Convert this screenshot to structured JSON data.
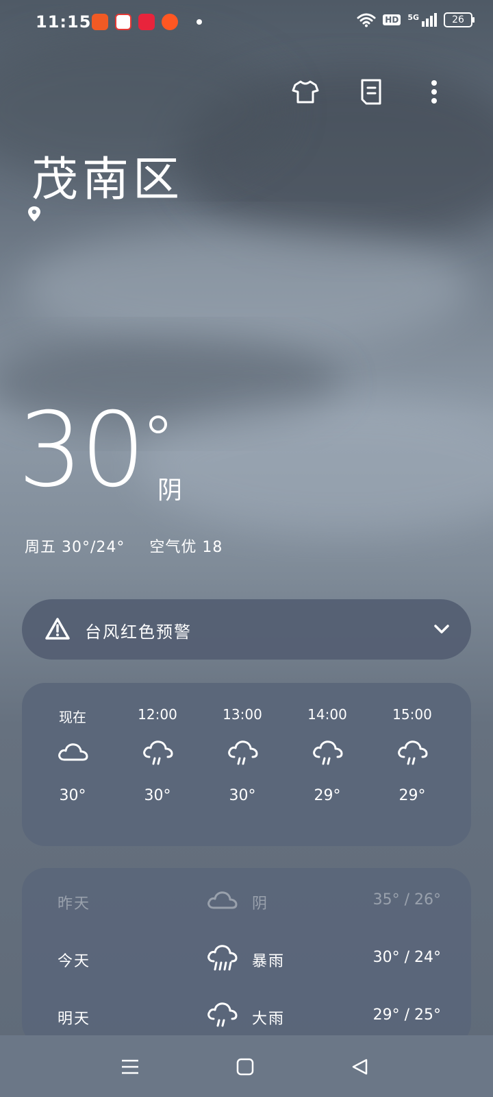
{
  "status_bar": {
    "time": "11:15",
    "app_icon_colors": [
      "#f15a24",
      "#e53935",
      "#e8243c",
      "#ff5722"
    ],
    "hd_label": "HD",
    "network_label": "5G",
    "battery": "26"
  },
  "top_actions": {
    "icons": [
      "shirt-icon",
      "document-icon",
      "more-vert-icon"
    ]
  },
  "location": {
    "city": "茂南区",
    "icon": "location-pin-icon"
  },
  "current": {
    "temperature": "30",
    "condition": "阴",
    "day_range": "周五 30°/24°",
    "air_quality": "空气优 18"
  },
  "alert": {
    "text": "台风红色预警",
    "icon": "warning-triangle-icon",
    "expand_icon": "chevron-down-icon"
  },
  "hourly": [
    {
      "time": "现在",
      "icon": "cloud-icon",
      "temp": "30°"
    },
    {
      "time": "12:00",
      "icon": "rain-icon",
      "temp": "30°"
    },
    {
      "time": "13:00",
      "icon": "rain-icon",
      "temp": "30°"
    },
    {
      "time": "14:00",
      "icon": "rain-icon",
      "temp": "29°"
    },
    {
      "time": "15:00",
      "icon": "rain-icon",
      "temp": "29°"
    }
  ],
  "daily": [
    {
      "day": "昨天",
      "icon": "cloud-icon",
      "condition": "阴",
      "range": "35° / 26°"
    },
    {
      "day": "今天",
      "icon": "heavy-rain-icon",
      "condition": "暴雨",
      "range": "30° / 24°"
    },
    {
      "day": "明天",
      "icon": "rain-icon",
      "condition": "大雨",
      "range": "29° / 25°"
    }
  ],
  "nav_bar": {
    "icons": [
      "menu-icon",
      "home-icon",
      "back-icon"
    ]
  }
}
